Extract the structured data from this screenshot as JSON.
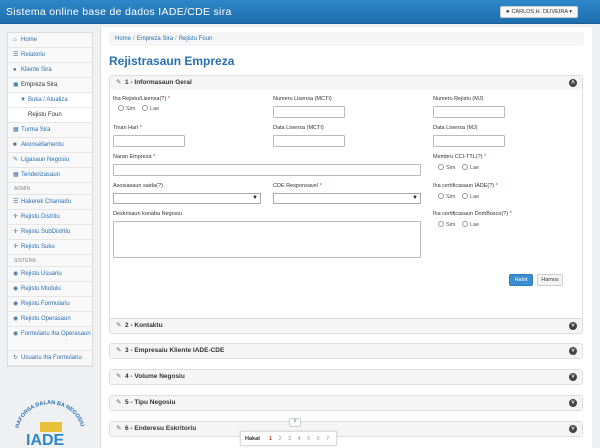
{
  "header": {
    "title": "Sistema online base de dados IADE/CDE sira",
    "user": "CARLOS H. OLIVEIRA"
  },
  "sidebar": {
    "items": [
      {
        "label": "Home",
        "icon": "home-icon"
      },
      {
        "label": "Relatoriu",
        "icon": "list-icon"
      },
      {
        "label": "Kliente Sira",
        "icon": "user-icon"
      },
      {
        "label": "Empreza Sira",
        "icon": "briefcase-icon"
      },
      {
        "label": "Buka / Atualiza",
        "icon": "filter-icon"
      },
      {
        "label": "Rejistu Foun",
        "icon": ""
      },
      {
        "label": "Turma Sira",
        "icon": "grid-icon"
      },
      {
        "label": "Akonsellamentu",
        "icon": "comment-icon"
      },
      {
        "label": "Ligasaun Negosiu",
        "icon": "pencil-icon"
      },
      {
        "label": "Tenderizasaun",
        "icon": "edit-icon"
      }
    ],
    "admin_heading": "ADMIN",
    "admin_items": [
      {
        "label": "Hakerek Chamadu",
        "icon": "list-icon"
      },
      {
        "label": "Rejistu Distritu",
        "icon": "move-icon"
      },
      {
        "label": "Rejistu SubDistritu",
        "icon": "move-icon"
      },
      {
        "label": "Rejistu Suku",
        "icon": "move-icon"
      }
    ],
    "sistema_heading": "SISTEMA",
    "sistema_items": [
      {
        "label": "Rejistu Usuariu",
        "icon": "lock-icon"
      },
      {
        "label": "Rejistu Modulu",
        "icon": "lock-icon"
      },
      {
        "label": "Rejistu Formulariu",
        "icon": "lock-icon"
      },
      {
        "label": "Rejistu Operasaun",
        "icon": "lock-icon"
      },
      {
        "label": "Formulariu iha Operasaun",
        "icon": "lock-icon"
      },
      {
        "label": "Usuariu iha Formulariu",
        "icon": "refresh-icon"
      }
    ],
    "logo_text": "IADE",
    "logo_arc": "HAFORSA DALAN BA NEGOSIU"
  },
  "breadcrumb": [
    "Home",
    "Empreza Sira",
    "Rejistu Foun"
  ],
  "page_title": "Rejistrasaun Empreza",
  "panel1": {
    "title": "1 - Informasaun Geral",
    "fields": {
      "iha_rejistu": "Iha Rejistu/Lisensa(?)",
      "numeru_lisensa": "Numeru Lisensa (MCTI)",
      "numeru_rejistu": "Numeru Rejistu (MJ)",
      "tinan_hari": "Tinan Hari",
      "data_lisensa_mcti": "Data Lisensa (MCTI)",
      "data_lisensa_mj": "Data Lisensa (MJ)",
      "naran_empreza": "Naran Empreza",
      "membru_cci": "Membru CCI-TTL(?)",
      "asosiasaun": "Asosiasaun saida(?)",
      "cde_responsavel": "CDE Responsavel",
      "iha_cert_iade": "Iha certificasaun IADE(?)",
      "deskrisaun": "Deskrisaun konaba Negosiu",
      "iha_cert_dombosco": "Iha certificasaun DomBosco(?)"
    },
    "radio_yes": "Sim",
    "radio_no": "Lae",
    "save_label": "Halot",
    "cancel_label": "Hamos"
  },
  "panels": [
    {
      "title": "2 - Kontaktu"
    },
    {
      "title": "3 - Empresaiu Kliente IADE-CDE"
    },
    {
      "title": "4 - Volume Negosiu"
    },
    {
      "title": "5 - Tipu Negosiu"
    },
    {
      "title": "6 - Enderesu Eskritoriu"
    }
  ],
  "pager": {
    "label": "Hakat",
    "pages": [
      "1",
      "2",
      "3",
      "4",
      "5",
      "6",
      "7"
    ],
    "current": "1"
  },
  "colors": {
    "topbar": "#2f87c9",
    "accent": "#2a6fb0",
    "required": "#c0392b",
    "save": "#3b8fd1"
  }
}
